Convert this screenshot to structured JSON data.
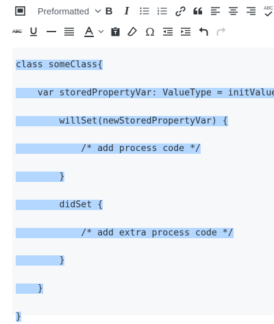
{
  "toolbar": {
    "format_select": {
      "value": "Preformatted"
    },
    "strikethrough_label": "ABC",
    "spellcheck_label": "ABC",
    "special_char_label": "Ω"
  },
  "code_lines": [
    "class someClass{",
    "",
    "    var storedPropertyVar: ValueType = initValue {",
    "",
    "        willSet(newStoredPropertyVar) {",
    "",
    "            /* add process code */",
    "",
    "        }",
    "",
    "        didSet {",
    "",
    "            /* add extra process code */",
    "",
    "        }",
    "",
    "    }",
    "",
    "}"
  ],
  "colors": {
    "selection": "#b4d7ff",
    "editor_bg": "#f6f8fa",
    "icon": "#555d66"
  }
}
